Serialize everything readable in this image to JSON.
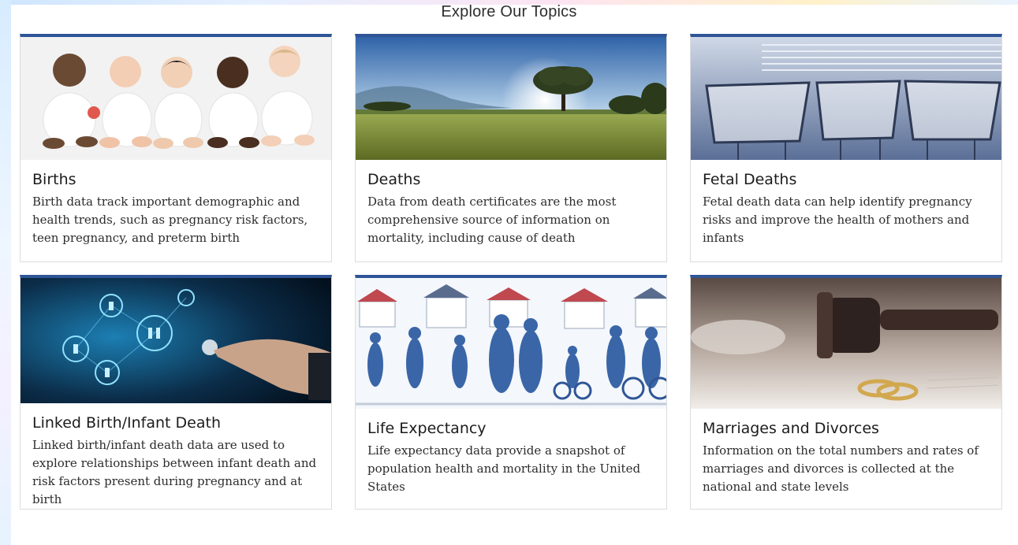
{
  "page": {
    "heading": "Explore Our Topics"
  },
  "cards": [
    {
      "title": "Births",
      "text": "Birth data track important demographic and health trends, such as pregnancy risk factors, teen pregnancy, and preterm birth",
      "image_subject": "babies-photo"
    },
    {
      "title": "Deaths",
      "text": "Data from death certificates are the most comprehensive source of information on mortality, including cause of death",
      "image_subject": "meadow-tree-photo"
    },
    {
      "title": "Fetal Deaths",
      "text": "Fetal death data can help identify pregnancy risks and improve the health of mothers and infants",
      "image_subject": "hospital-bassinets-photo"
    },
    {
      "title": "Linked Birth/Infant Death",
      "text": "Linked birth/infant death data are used to explore relationships between infant death and risk factors present during pregnancy and at birth",
      "image_subject": "digital-network-hand-photo"
    },
    {
      "title": "Life Expectancy",
      "text": "Life expectancy data provide a snapshot of population health and mortality in the United States",
      "image_subject": "crowd-illustration"
    },
    {
      "title": "Marriages and Divorces",
      "text": "Information on the total numbers and rates of marriages and divorces is collected at the national and state levels",
      "image_subject": "gavel-rings-photo"
    }
  ],
  "colors": {
    "card_top_border": "#2f5597",
    "heading_text": "#2e2e2e"
  }
}
